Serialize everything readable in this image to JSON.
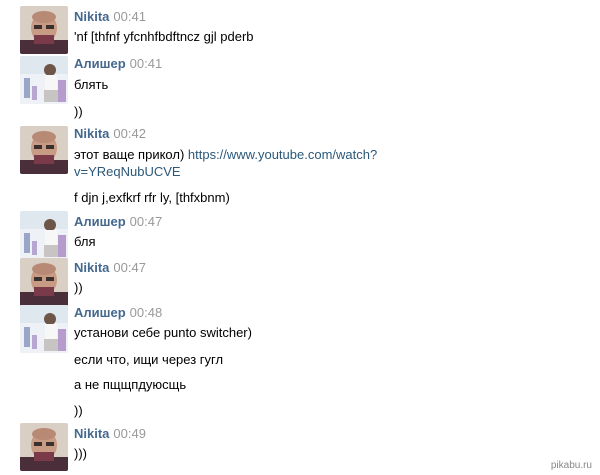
{
  "messages": [
    {
      "author": "Nikita",
      "time": "00:41",
      "avatar": "avatar-nikita-icon",
      "lines": [
        "'nf [thfnf yfcnhfbdftncz gjl pderb"
      ]
    },
    {
      "author": "Алишер",
      "time": "00:41",
      "avatar": "avatar-alisher-icon",
      "lines": [
        "блять",
        "))"
      ]
    },
    {
      "author": "Nikita",
      "time": "00:42",
      "avatar": "avatar-nikita-icon",
      "text_prefix": "этот ваще прикол) ",
      "link_line1": "https://www.youtube.com/watch?",
      "link_line2": "v=YReqNubUCVE",
      "lines_after": [
        "f djn j,exfkrf rfr ly, [thfxbnm)"
      ]
    },
    {
      "author": "Алишер",
      "time": "00:47",
      "avatar": "avatar-alisher-icon",
      "lines": [
        "бля"
      ]
    },
    {
      "author": "Nikita",
      "time": "00:47",
      "avatar": "avatar-nikita-icon",
      "lines": [
        "))"
      ]
    },
    {
      "author": "Алишер",
      "time": "00:48",
      "avatar": "avatar-alisher-icon",
      "lines": [
        "установи себе punto switcher)",
        "если что, ищи через гугл",
        "а не пщщпдуюсщь",
        "))"
      ]
    },
    {
      "author": "Nikita",
      "time": "00:49",
      "avatar": "avatar-nikita-icon",
      "lines": [
        ")))"
      ]
    }
  ],
  "watermark": "pikabu.ru",
  "colors": {
    "author": "#45688e",
    "time": "#999999",
    "link": "#2b587a"
  }
}
